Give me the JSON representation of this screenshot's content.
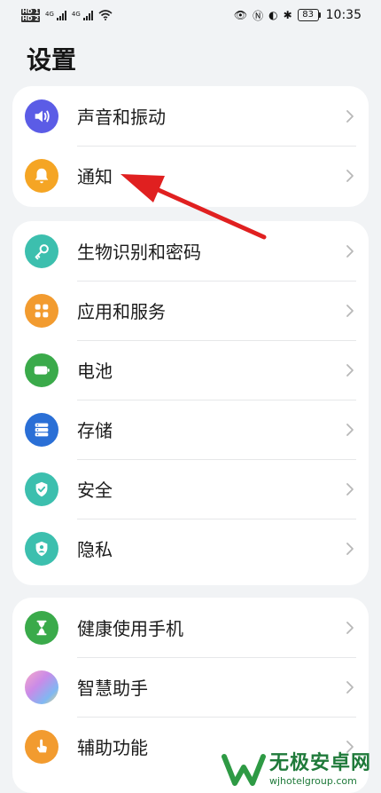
{
  "status_bar": {
    "network_1": "4G",
    "network_2": "4G",
    "battery": "83",
    "time": "10:35"
  },
  "page": {
    "title": "设置"
  },
  "groups": [
    {
      "items": [
        {
          "label": "声音和振动",
          "icon": "speaker-icon",
          "color": "#5b5ce6"
        },
        {
          "label": "通知",
          "icon": "bell-icon",
          "color": "#f5a524"
        }
      ]
    },
    {
      "items": [
        {
          "label": "生物识别和密码",
          "icon": "key-icon",
          "color": "#3cbfae"
        },
        {
          "label": "应用和服务",
          "icon": "apps-grid-icon",
          "color": "#f29b2f"
        },
        {
          "label": "电池",
          "icon": "battery-icon",
          "color": "#3aaa4a"
        },
        {
          "label": "存储",
          "icon": "storage-icon",
          "color": "#2a6fd6"
        },
        {
          "label": "安全",
          "icon": "shield-check-icon",
          "color": "#3cbfae"
        },
        {
          "label": "隐私",
          "icon": "privacy-shield-icon",
          "color": "#3cbfae"
        }
      ]
    },
    {
      "items": [
        {
          "label": "健康使用手机",
          "icon": "hourglass-icon",
          "color": "#3aaa4a"
        },
        {
          "label": "智慧助手",
          "icon": "assistant-orb-icon",
          "color": "#c98be8"
        },
        {
          "label": "辅助功能",
          "icon": "hand-touch-icon",
          "color": "#f29b2f"
        }
      ]
    }
  ],
  "watermark": {
    "name": "无极安卓网",
    "url": "wjhotelgroup.com",
    "color": "#1f7a3a"
  },
  "annotation": {
    "arrow_color": "#e02020"
  }
}
